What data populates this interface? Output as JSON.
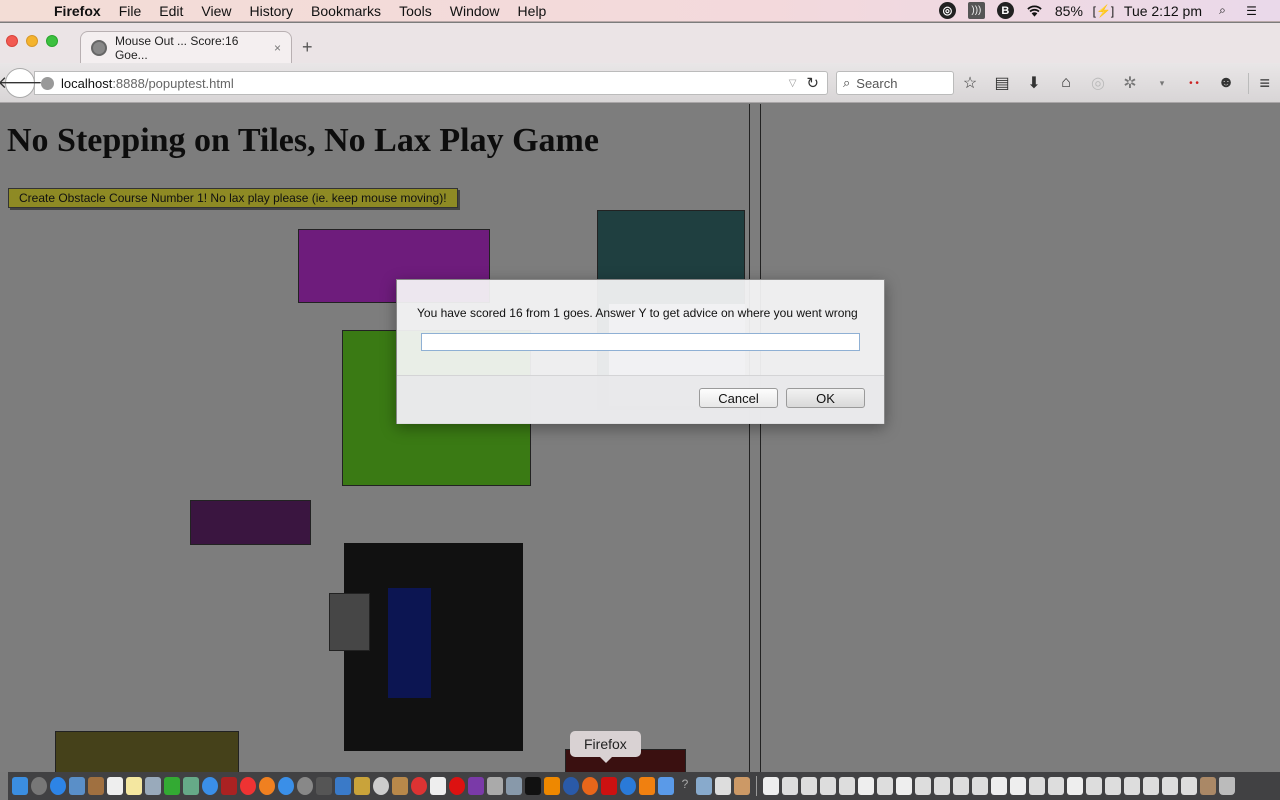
{
  "menubar": {
    "apple": "",
    "app_name": "Firefox",
    "items": [
      "File",
      "Edit",
      "View",
      "History",
      "Bookmarks",
      "Tools",
      "Window",
      "Help"
    ],
    "battery": "85%",
    "clock": "Tue 2:12 pm",
    "status_icons": [
      "circle-app-icon",
      "sound-icon",
      "b-app-icon",
      "wifi-icon",
      "battery-icon",
      "spotlight-icon",
      "notification-center-icon"
    ]
  },
  "browser": {
    "tab_title": "Mouse Out ... Score:16 Goe...",
    "tab_close": "×",
    "new_tab": "+",
    "url_host": "localhost",
    "url_path": ":8888/popuptest.html",
    "search_placeholder": "Search",
    "toolbar_icons": [
      "bookmark-star-icon",
      "reading-list-icon",
      "download-icon",
      "home-icon",
      "pocket-icon",
      "extension-icon",
      "dropdown-icon",
      "dots-icon",
      "smiley-icon"
    ]
  },
  "page": {
    "title": "No Stepping on Tiles, No Lax Play Game",
    "create_button": "Create Obstacle Course Number 1!  No lax play please (ie. keep mouse moving)!",
    "tiles": [
      {
        "name": "purple-tile",
        "color": "#7a1e8a"
      },
      {
        "name": "teal-tile",
        "color": "#1f3f40"
      },
      {
        "name": "green-tile",
        "color": "#3a7a14"
      },
      {
        "name": "dark-purple-tile",
        "color": "#3a1540"
      },
      {
        "name": "black-tile",
        "color": "#111111"
      },
      {
        "name": "gray-tile",
        "color": "#464646"
      },
      {
        "name": "navy-tile",
        "color": "#0c1552"
      },
      {
        "name": "olive-tile",
        "color": "#45411a"
      },
      {
        "name": "maroon-tile",
        "color": "#3a1010"
      },
      {
        "name": "lavender-tile",
        "color": "#e6e4f0"
      }
    ]
  },
  "dialog": {
    "message": "You have scored 16 from 1 goes.  Answer Y to get advice on where you went wrong",
    "input_value": "",
    "cancel_label": "Cancel",
    "ok_label": "OK"
  },
  "dock": {
    "tooltip": "Firefox"
  }
}
